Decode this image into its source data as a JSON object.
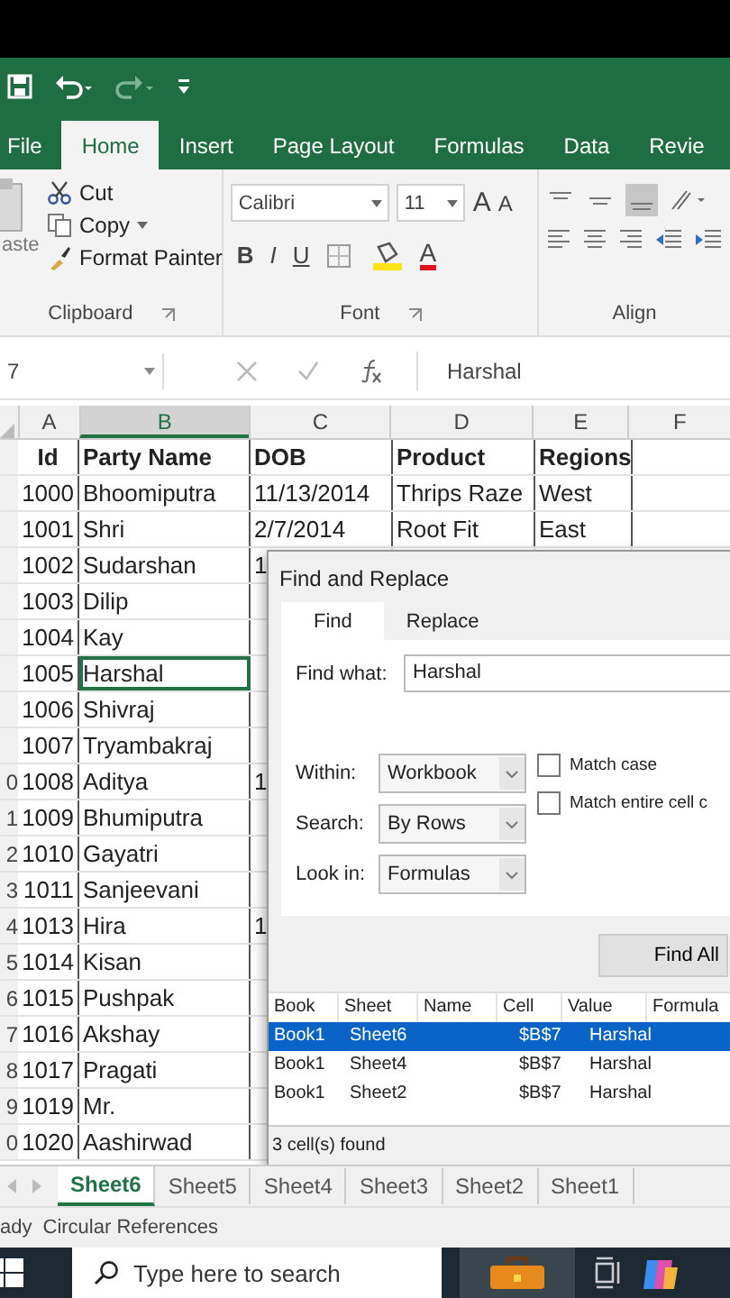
{
  "ribbon_tabs": [
    {
      "label": "File",
      "selected": false
    },
    {
      "label": "Home",
      "selected": true
    },
    {
      "label": "Insert",
      "selected": false
    },
    {
      "label": "Page Layout",
      "selected": false
    },
    {
      "label": "Formulas",
      "selected": false
    },
    {
      "label": "Data",
      "selected": false
    },
    {
      "label": "Revie",
      "selected": false
    }
  ],
  "clipboard": {
    "paste": "aste",
    "cut": "Cut",
    "copy": "Copy",
    "format_painter": "Format Painter",
    "group": "Clipboard"
  },
  "font": {
    "name": "Calibri",
    "size": "11",
    "grow": "A",
    "shrink": "A",
    "bold": "B",
    "italic": "I",
    "underline": "U",
    "color_letter": "A",
    "group": "Font"
  },
  "alignment": {
    "group": "Align"
  },
  "formula_bar": {
    "name_box": "7",
    "value": "Harshal"
  },
  "columns": [
    {
      "label": "A",
      "selected": false
    },
    {
      "label": "B",
      "selected": true
    },
    {
      "label": "C",
      "selected": false
    },
    {
      "label": "D",
      "selected": false
    },
    {
      "label": "E",
      "selected": false
    },
    {
      "label": "F",
      "selected": false
    }
  ],
  "rows": [
    {
      "number": "",
      "kind": "header",
      "active": false,
      "cells": [
        "Id",
        "Party Name",
        "DOB",
        "Product",
        "Regions"
      ]
    },
    {
      "number": "",
      "kind": "data",
      "active": false,
      "cells": [
        "1000",
        "Bhoomiputra",
        "11/13/2014",
        "Thrips Raze",
        "West"
      ]
    },
    {
      "number": "",
      "kind": "data",
      "active": false,
      "cells": [
        "1001",
        "Shri",
        "2/7/2014",
        "Root Fit",
        "East"
      ]
    },
    {
      "number": "",
      "kind": "data",
      "active": false,
      "cells": [
        "1002",
        "Sudarshan",
        "1"
      ]
    },
    {
      "number": "",
      "kind": "data",
      "active": false,
      "cells": [
        "1003",
        "Dilip"
      ]
    },
    {
      "number": "",
      "kind": "data",
      "active": false,
      "cells": [
        "1004",
        "Kay"
      ]
    },
    {
      "number": "",
      "kind": "data",
      "active": true,
      "cells": [
        "1005",
        "Harshal"
      ]
    },
    {
      "number": "",
      "kind": "data",
      "active": false,
      "cells": [
        "1006",
        "Shivraj"
      ]
    },
    {
      "number": "",
      "kind": "data",
      "active": false,
      "cells": [
        "1007",
        "Tryambakraj"
      ]
    },
    {
      "number": "0",
      "kind": "data",
      "active": false,
      "cells": [
        "1008",
        "Aditya",
        "1"
      ]
    },
    {
      "number": "1",
      "kind": "data",
      "active": false,
      "cells": [
        "1009",
        "Bhumiputra"
      ]
    },
    {
      "number": "2",
      "kind": "data",
      "active": false,
      "cells": [
        "1010",
        "Gayatri"
      ]
    },
    {
      "number": "3",
      "kind": "data",
      "active": false,
      "cells": [
        "1011",
        "Sanjeevani"
      ]
    },
    {
      "number": "4",
      "kind": "data",
      "active": false,
      "cells": [
        "1013",
        "Hira",
        "1"
      ]
    },
    {
      "number": "5",
      "kind": "data",
      "active": false,
      "cells": [
        "1014",
        "Kisan"
      ]
    },
    {
      "number": "6",
      "kind": "data",
      "active": false,
      "cells": [
        "1015",
        "Pushpak"
      ]
    },
    {
      "number": "7",
      "kind": "data",
      "active": false,
      "cells": [
        "1016",
        "Akshay"
      ]
    },
    {
      "number": "8",
      "kind": "data",
      "active": false,
      "cells": [
        "1017",
        "Pragati"
      ]
    },
    {
      "number": "9",
      "kind": "data",
      "active": false,
      "cells": [
        "1019",
        "Mr."
      ]
    },
    {
      "number": "0",
      "kind": "data",
      "active": false,
      "cells": [
        "1020",
        "Aashirwad"
      ]
    }
  ],
  "dialog": {
    "title": "Find and Replace",
    "tabs": [
      {
        "label": "Find",
        "selected": true
      },
      {
        "label": "Replace",
        "selected": false
      }
    ],
    "find_what": {
      "label": "Find what:",
      "value": "Harshal"
    },
    "options": [
      {
        "label": "Within:",
        "value": "Workbook"
      },
      {
        "label": "Search:",
        "value": "By Rows"
      },
      {
        "label": "Look in:",
        "value": "Formulas"
      }
    ],
    "checkboxes": [
      {
        "label": "Match case",
        "checked": false
      },
      {
        "label": "Match entire cell c",
        "checked": false
      }
    ],
    "find_all": "Find All",
    "results": {
      "columns": [
        "Book",
        "Sheet",
        "Name",
        "Cell",
        "Value",
        "Formula"
      ],
      "rows": [
        {
          "cells": [
            "Book1",
            "Sheet6",
            "",
            "$B$7",
            "Harshal"
          ],
          "selected": true
        },
        {
          "cells": [
            "Book1",
            "Sheet4",
            "",
            "$B$7",
            "Harshal"
          ],
          "selected": false
        },
        {
          "cells": [
            "Book1",
            "Sheet2",
            "",
            "$B$7",
            "Harshal"
          ],
          "selected": false
        }
      ]
    },
    "status": "3 cell(s) found"
  },
  "sheet_tabs": [
    {
      "label": "Sheet6",
      "selected": true
    },
    {
      "label": "Sheet5",
      "selected": false
    },
    {
      "label": "Sheet4",
      "selected": false
    },
    {
      "label": "Sheet3",
      "selected": false
    },
    {
      "label": "Sheet2",
      "selected": false
    },
    {
      "label": "Sheet1",
      "selected": false
    }
  ],
  "status_bar": [
    "ady",
    "Circular References"
  ],
  "taskbar": {
    "search_placeholder": "Type here to search"
  }
}
